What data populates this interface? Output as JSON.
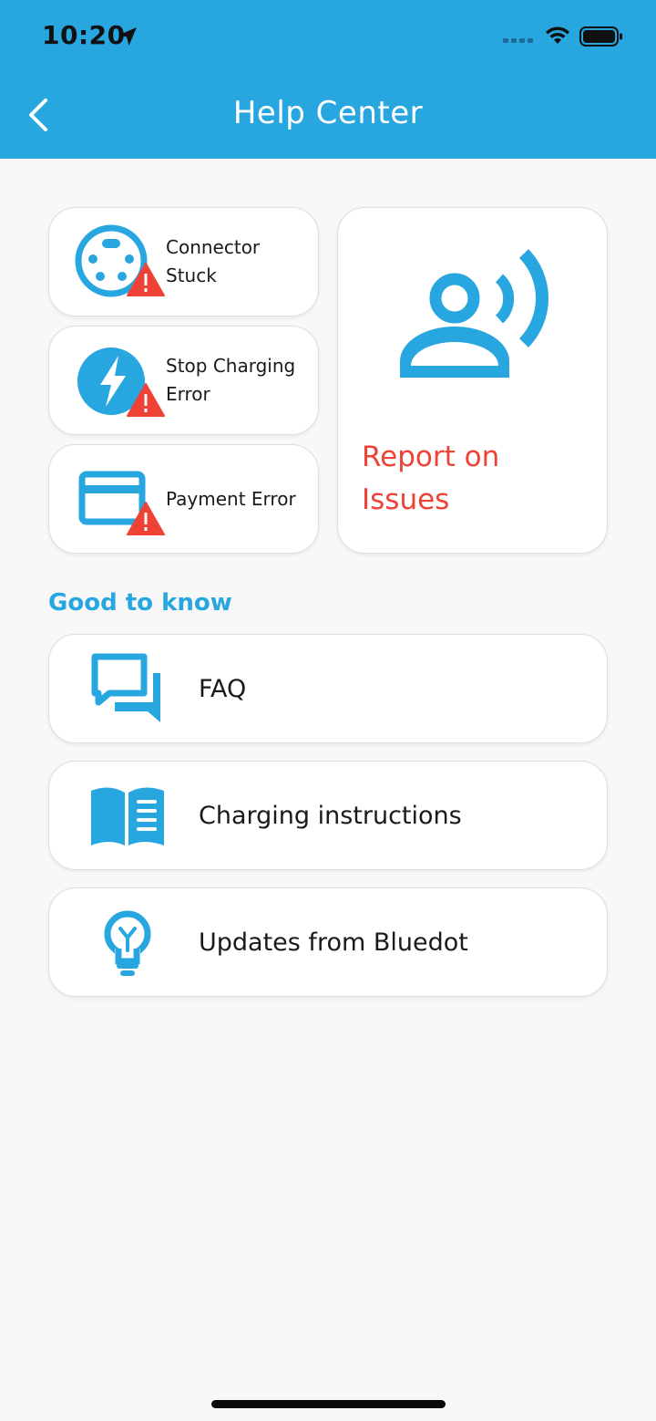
{
  "status_bar": {
    "time": "10:20"
  },
  "header": {
    "title": "Help Center"
  },
  "issues": [
    {
      "label": "Connector Stuck",
      "icon": "connector-warning-icon"
    },
    {
      "label": "Stop Charging Error",
      "icon": "lightning-warning-icon"
    },
    {
      "label": "Payment Error",
      "icon": "card-warning-icon"
    }
  ],
  "report": {
    "label": "Report on Issues",
    "icon": "person-signal-icon"
  },
  "good_to_know": {
    "title": "Good to know",
    "items": [
      {
        "label": "FAQ",
        "icon": "chat-bubbles-icon"
      },
      {
        "label": "Charging instructions",
        "icon": "book-icon"
      },
      {
        "label": "Updates from Bluedot",
        "icon": "lightbulb-icon"
      }
    ]
  },
  "colors": {
    "primary": "#27a6e0",
    "alert": "#ee4236",
    "background": "#f8f8f8"
  }
}
